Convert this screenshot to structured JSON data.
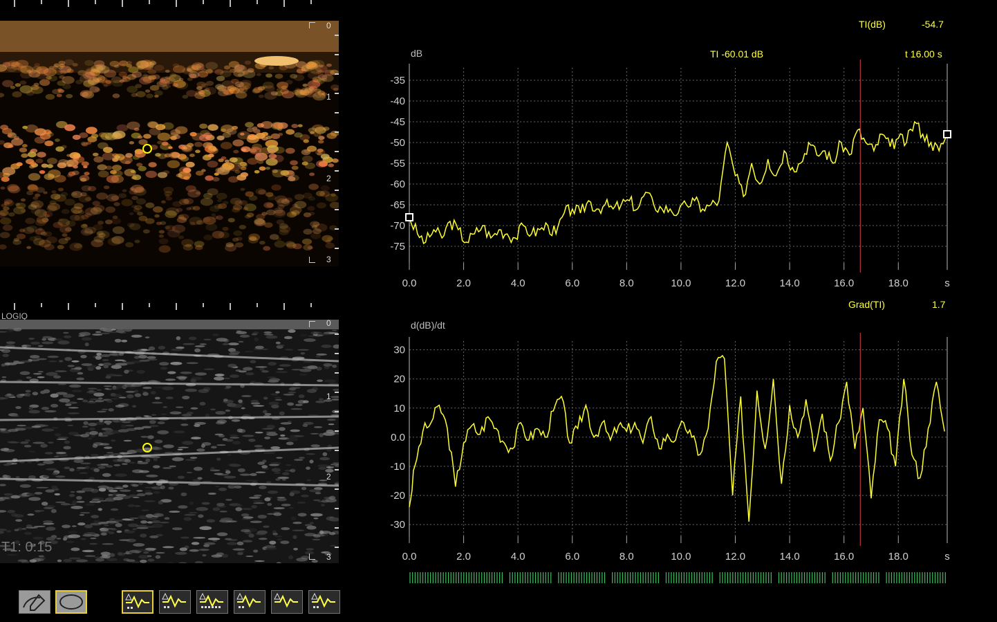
{
  "top_ticks_count": 12,
  "contrast_image": {
    "depth_labels": [
      "0",
      "1",
      "2",
      "3"
    ],
    "roi_color": "#ffff00"
  },
  "bmode_image": {
    "brand_label": "LOGIQ",
    "timer_label": "T1: 0:15",
    "depth_labels": [
      "0",
      "1",
      "2",
      "3"
    ],
    "roi_color": "#ffff00"
  },
  "readouts": {
    "ti_name": "TI(dB)",
    "ti_value": "-54.7",
    "grad_name": "Grad(TI)",
    "grad_value": "1.7"
  },
  "chart_data": [
    {
      "type": "line",
      "ylabel": "dB",
      "title": "TI -60.01 dB",
      "cursor_label": "t 16.00 s",
      "xunit": "s",
      "xticks": [
        "0.0",
        "2.0",
        "4.0",
        "6.0",
        "8.0",
        "10.0",
        "12.0",
        "14.0",
        "16.0",
        "18.0"
      ],
      "yticks": [
        "-35",
        "-40",
        "-45",
        "-50",
        "-55",
        "-60",
        "-65",
        "-70",
        "-75"
      ],
      "xlim": [
        0,
        19.8
      ],
      "ylim": [
        -79,
        -32
      ],
      "cursor_x": 16.6,
      "line_color": "#ffff33",
      "cursor_color": "#e04040",
      "series": [
        {
          "values": [
            [
              0.0,
              -68
            ],
            [
              0.3,
              -72
            ],
            [
              0.6,
              -74
            ],
            [
              0.9,
              -71
            ],
            [
              1.2,
              -73
            ],
            [
              1.5,
              -69
            ],
            [
              1.8,
              -71
            ],
            [
              2.1,
              -74
            ],
            [
              2.4,
              -72
            ],
            [
              2.7,
              -70
            ],
            [
              3.0,
              -73
            ],
            [
              3.3,
              -71
            ],
            [
              3.6,
              -72
            ],
            [
              3.9,
              -73
            ],
            [
              4.2,
              -70
            ],
            [
              4.5,
              -72
            ],
            [
              4.8,
              -71
            ],
            [
              5.1,
              -70
            ],
            [
              5.4,
              -72
            ],
            [
              5.7,
              -67
            ],
            [
              6.0,
              -66
            ],
            [
              6.3,
              -67
            ],
            [
              6.6,
              -64
            ],
            [
              6.9,
              -66
            ],
            [
              7.2,
              -65
            ],
            [
              7.5,
              -66
            ],
            [
              7.8,
              -65
            ],
            [
              8.1,
              -64
            ],
            [
              8.4,
              -66
            ],
            [
              8.7,
              -62
            ],
            [
              9.0,
              -65
            ],
            [
              9.3,
              -66
            ],
            [
              9.6,
              -66
            ],
            [
              9.9,
              -67
            ],
            [
              10.2,
              -65
            ],
            [
              10.5,
              -64
            ],
            [
              10.8,
              -66
            ],
            [
              11.1,
              -65
            ],
            [
              11.4,
              -64
            ],
            [
              11.7,
              -50
            ],
            [
              12.0,
              -58
            ],
            [
              12.3,
              -63
            ],
            [
              12.6,
              -55
            ],
            [
              12.9,
              -60
            ],
            [
              13.2,
              -54
            ],
            [
              13.5,
              -58
            ],
            [
              13.8,
              -52
            ],
            [
              14.1,
              -56
            ],
            [
              14.4,
              -55
            ],
            [
              14.7,
              -50
            ],
            [
              15.0,
              -53
            ],
            [
              15.3,
              -52
            ],
            [
              15.6,
              -55
            ],
            [
              15.9,
              -50
            ],
            [
              16.2,
              -53
            ],
            [
              16.5,
              -47
            ],
            [
              16.8,
              -50
            ],
            [
              17.1,
              -52
            ],
            [
              17.4,
              -48
            ],
            [
              17.7,
              -51
            ],
            [
              18.0,
              -49
            ],
            [
              18.3,
              -50
            ],
            [
              18.6,
              -45
            ],
            [
              18.9,
              -48
            ],
            [
              19.2,
              -50
            ],
            [
              19.5,
              -52
            ],
            [
              19.8,
              -48
            ]
          ]
        }
      ]
    },
    {
      "type": "line",
      "ylabel": "d(dB)/dt",
      "xunit": "s",
      "xticks": [
        "0.0",
        "2.0",
        "4.0",
        "6.0",
        "8.0",
        "10.0",
        "12.0",
        "14.0",
        "16.0",
        "18.0"
      ],
      "yticks": [
        "30",
        "20",
        "10",
        "0.0",
        "-10",
        "-20",
        "-30"
      ],
      "xlim": [
        0,
        19.8
      ],
      "ylim": [
        -34,
        33
      ],
      "cursor_x": 16.6,
      "line_color": "#ffff33",
      "cursor_color": "#e04040",
      "series": [
        {
          "values": [
            [
              0.0,
              -24
            ],
            [
              0.2,
              -10
            ],
            [
              0.5,
              2
            ],
            [
              0.8,
              5
            ],
            [
              1.1,
              11
            ],
            [
              1.4,
              3
            ],
            [
              1.7,
              -17
            ],
            [
              2.0,
              -2
            ],
            [
              2.3,
              4
            ],
            [
              2.6,
              1
            ],
            [
              2.9,
              7
            ],
            [
              3.2,
              3
            ],
            [
              3.5,
              -2
            ],
            [
              3.8,
              -4
            ],
            [
              4.1,
              5
            ],
            [
              4.4,
              -1
            ],
            [
              4.7,
              3
            ],
            [
              5.0,
              0
            ],
            [
              5.3,
              9
            ],
            [
              5.6,
              14
            ],
            [
              5.9,
              -2
            ],
            [
              6.2,
              3
            ],
            [
              6.5,
              11
            ],
            [
              6.8,
              0
            ],
            [
              7.1,
              5
            ],
            [
              7.4,
              -1
            ],
            [
              7.7,
              4
            ],
            [
              8.0,
              2
            ],
            [
              8.3,
              5
            ],
            [
              8.6,
              -2
            ],
            [
              8.9,
              7
            ],
            [
              9.2,
              -4
            ],
            [
              9.5,
              1
            ],
            [
              9.8,
              -1
            ],
            [
              10.1,
              5
            ],
            [
              10.4,
              0
            ],
            [
              10.7,
              -6
            ],
            [
              11.0,
              3
            ],
            [
              11.3,
              26
            ],
            [
              11.6,
              27
            ],
            [
              11.9,
              -20
            ],
            [
              12.2,
              14
            ],
            [
              12.5,
              -29
            ],
            [
              12.8,
              16
            ],
            [
              13.1,
              -4
            ],
            [
              13.4,
              20
            ],
            [
              13.7,
              -16
            ],
            [
              14.0,
              11
            ],
            [
              14.3,
              0
            ],
            [
              14.6,
              13
            ],
            [
              14.9,
              -5
            ],
            [
              15.2,
              8
            ],
            [
              15.5,
              -8
            ],
            [
              15.8,
              5
            ],
            [
              16.1,
              19
            ],
            [
              16.4,
              -4
            ],
            [
              16.7,
              10
            ],
            [
              17.0,
              -21
            ],
            [
              17.3,
              6
            ],
            [
              17.6,
              3
            ],
            [
              17.9,
              -10
            ],
            [
              18.2,
              20
            ],
            [
              18.5,
              -6
            ],
            [
              18.8,
              -14
            ],
            [
              19.1,
              3
            ],
            [
              19.4,
              19
            ],
            [
              19.7,
              2
            ]
          ]
        }
      ]
    }
  ],
  "event_bar": {
    "color": "#40c060",
    "marker_count": 210,
    "gaps": [
      0.18,
      0.27,
      0.37,
      0.47,
      0.57,
      0.68,
      0.78,
      0.88
    ]
  },
  "toolbar": {
    "buttons": [
      {
        "name": "trace-roi-button",
        "icon": "pencil-trace-icon",
        "selected": false,
        "style": "gray"
      },
      {
        "name": "ellipse-roi-button",
        "icon": "ellipse-icon",
        "selected": true,
        "style": "gray"
      },
      {
        "name": "layout-1-button",
        "icon": "layout-single-curve-icon",
        "selected": true,
        "style": "dark"
      },
      {
        "name": "layout-2-button",
        "icon": "layout-grid-curve-icon",
        "selected": false,
        "style": "dark"
      },
      {
        "name": "layout-3-button",
        "icon": "layout-wide-grid-curve-icon",
        "selected": false,
        "style": "dark"
      },
      {
        "name": "layout-4-button",
        "icon": "layout-dual-image-curve-icon",
        "selected": false,
        "style": "dark"
      },
      {
        "name": "layout-5-button",
        "icon": "layout-image-curve-icon",
        "selected": false,
        "style": "dark"
      },
      {
        "name": "layout-6-button",
        "icon": "layout-dual-image-dual-curve-icon",
        "selected": false,
        "style": "dark"
      }
    ]
  }
}
